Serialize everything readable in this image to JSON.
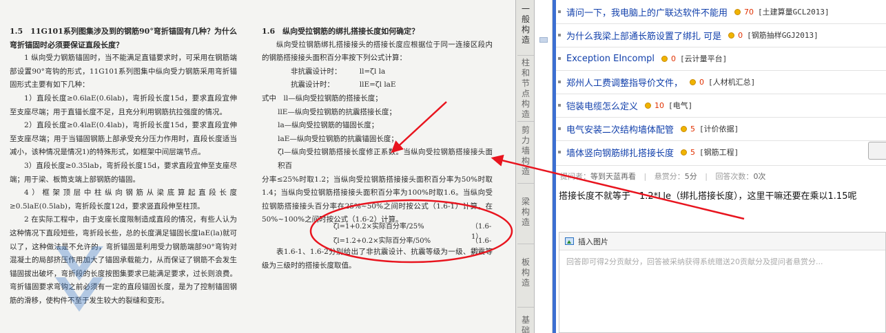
{
  "doc": {
    "left": [
      {
        "cls": "h",
        "text": "1.5　11G101系列图集涉及到的钢筋90°弯折锚固有几种？为什么弯折锚固时必须要保证直段长度？"
      },
      {
        "cls": "ind",
        "text": "1 纵向受力钢筋锚固时，当不能满足直锚要求时，可采用在钢筋端部设置90°弯钩的形式，11G101系列图集中纵向受力钢筋采用弯折锚固形式主要有如下几种："
      },
      {
        "cls": "ind",
        "text": "1）直段长度≥0.6laE(0.6lab)，弯折段长度15d，要求直段宜伸至支座尽端；用于直锚长度不足，且充分利用钢筋抗拉强度的情况。"
      },
      {
        "cls": "ind",
        "text": "2）直段长度≥0.4laE(0.4lab)，弯折段长度15d，要求直段宜伸至支座尽端；用于当锚固钢筋上部承受充分压力作用时，直段长度适当减小，该种情况是情况1)的特殊形式，如框架中间层端节点。"
      },
      {
        "cls": "ind",
        "text": "3）直段长度≥0.35lab，弯折段长度15d，要求直段宜伸至支座尽端；用于梁、板筒支端上部钢筋的锚固。"
      },
      {
        "cls": "ind",
        "text": "4）框架顶层中柱纵向钢筋从梁底算起直段长度≥0.5laE(0.5lab)，弯折段长度12d，要求竖直段伸至柱顶。"
      },
      {
        "cls": "ind",
        "text": "2 在实际工程中，由于支座长度限制造成直段的情况，有些人认为这种情况下直段短些，弯折段长些，总的长度满足锚固长度laE(la)就可以了，这种做法是不允许的，弯折锚固是利用受力钢筋端部90°弯钩对混凝土的局部挤压作用加大了锚固承载能力，从而保证了钢筋不会发生锚固拔出破坏，弯折段的长度按图集要求已能满足要求，过长则浪费。弯折锚固要求弯钩之前必须有一定的直段锚固长度，是为了控制锚固钢筋的滑移，使构件不至于发生较大的裂缝和变形。"
      }
    ],
    "right": [
      {
        "cls": "h",
        "text": "1.6　纵向受拉钢筋的绑扎搭接长度如何确定？"
      },
      {
        "cls": "ind",
        "text": "纵向受拉钢筋绑扎搭接接头的搭接长度应根据位于同一连接区段内的钢筋搭接接头面积百分率按下列公式计算："
      },
      {
        "cls": "f",
        "text": "非抗震设计时：　　　ll=ζl la"
      },
      {
        "cls": "f",
        "text": "抗震设计时：　　　　llE=ζl laE"
      },
      {
        "cls": "",
        "text": "式中　ll—纵向受拉钢筋的搭接长度；"
      },
      {
        "cls": "f2",
        "text": "llE—纵向受拉钢筋的抗震搭接长度；"
      },
      {
        "cls": "f2",
        "text": "la—纵向受拉钢筋的锚固长度；"
      },
      {
        "cls": "f2",
        "text": "laE—纵向受拉钢筋的抗震锚固长度；"
      },
      {
        "cls": "f2",
        "text": "ζl—纵向受拉钢筋搭接长度修正系数。当纵向受拉钢筋搭接接头面积百"
      },
      {
        "cls": "",
        "text": "分率≤25%时取1.2；当纵向受拉钢筋搭接接头面积百分率为50%时取1.4；当纵向受拉钢筋搭接接头面积百分率为100%时取1.6。当纵向受拉钢筋搭接接头百分率在25%~50%之间时按公式（1.6-1）计算，在50%~100%之间时按公式（1.6-2）计算。"
      }
    ],
    "formulas": [
      {
        "expr": "ζl=1+0.2×实际百分率/25%",
        "no": "（1.6-1）"
      },
      {
        "expr": "ζl=1.2+0.2×实际百分率/50%",
        "no": "（1.6-2）"
      }
    ],
    "tail": "表1.6-1、1.6-2分别给出了非抗震设计、抗震等级为一级、抗震等级为三级时的搭接长度取值。"
  },
  "tabs": [
    {
      "label": "一般构造",
      "selected": true
    },
    {
      "label": "柱和节点构造",
      "selected": false
    },
    {
      "label": "剪力墙构造",
      "selected": false
    },
    {
      "label": "梁构造",
      "selected": false
    },
    {
      "label": "板构造",
      "selected": false
    },
    {
      "label": "基础",
      "selected": false
    }
  ],
  "questions": [
    {
      "title": "请问一下，我电脑上的广联达软件不能用",
      "score": "70",
      "category": "[土建算量GCL2013]"
    },
    {
      "title": "为什么我梁上部通长筋设置了绑扎 可是",
      "score": "0",
      "category": "[钢筋抽样GGJ2013]"
    },
    {
      "title": "Exception EIncompl",
      "score": "0",
      "category": "[云计量平台]"
    },
    {
      "title": "郑州人工费调整指导价文件，",
      "score": "0",
      "category": "[人材机汇总]"
    },
    {
      "title": "铠装电缆怎么定义",
      "score": "10",
      "category": "[电气]"
    },
    {
      "title": "电气安装二次结构墙体配管",
      "score": "5",
      "category": "[计价依据]"
    },
    {
      "title": "墙体竖向钢筋绑扎搭接长度",
      "score": "5",
      "category": "[钢筋工程]"
    }
  ],
  "meta": {
    "asker_label": "提问者：",
    "asker": "等到天蓝再看",
    "bounty_label": "悬赏分：",
    "bounty": "5分",
    "answers_label": "回答次数：",
    "answers": "0次"
  },
  "content": "搭接长度不就等于　1.2*Lle（绑扎搭接长度），这里干嘛还要在乘以1.15呢",
  "answer_box": {
    "insert_image": "插入图片",
    "placeholder": "回答即可得2分贡献分，回答被采纳获得系统赠送20贡献分及提问者悬赏分..."
  },
  "colors": {
    "annotation": "#e8141e",
    "link": "#1240ab",
    "score": "#e03000",
    "accent": "#3c6fd1"
  }
}
